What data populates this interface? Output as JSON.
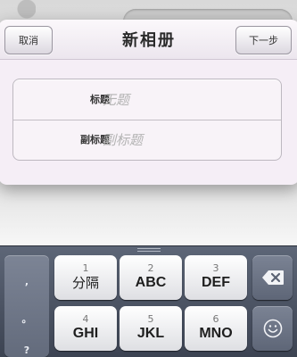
{
  "nav": {
    "cancel_label": "取消",
    "title": "新相册",
    "next_label": "下一步"
  },
  "form": {
    "title_label": "标题",
    "title_placeholder": "无题",
    "subtitle_label": "副标题",
    "subtitle_placeholder": "副标题"
  },
  "keyboard": {
    "side_keys": [
      ",",
      "。",
      "?"
    ],
    "keys": [
      {
        "num": "1",
        "label": "分隔"
      },
      {
        "num": "2",
        "label": "ABC"
      },
      {
        "num": "3",
        "label": "DEF"
      },
      {
        "num": "4",
        "label": "GHI"
      },
      {
        "num": "5",
        "label": "JKL"
      },
      {
        "num": "6",
        "label": "MNO"
      }
    ],
    "icons": {
      "delete": "backspace-icon",
      "emoji": "smiley-icon"
    }
  }
}
